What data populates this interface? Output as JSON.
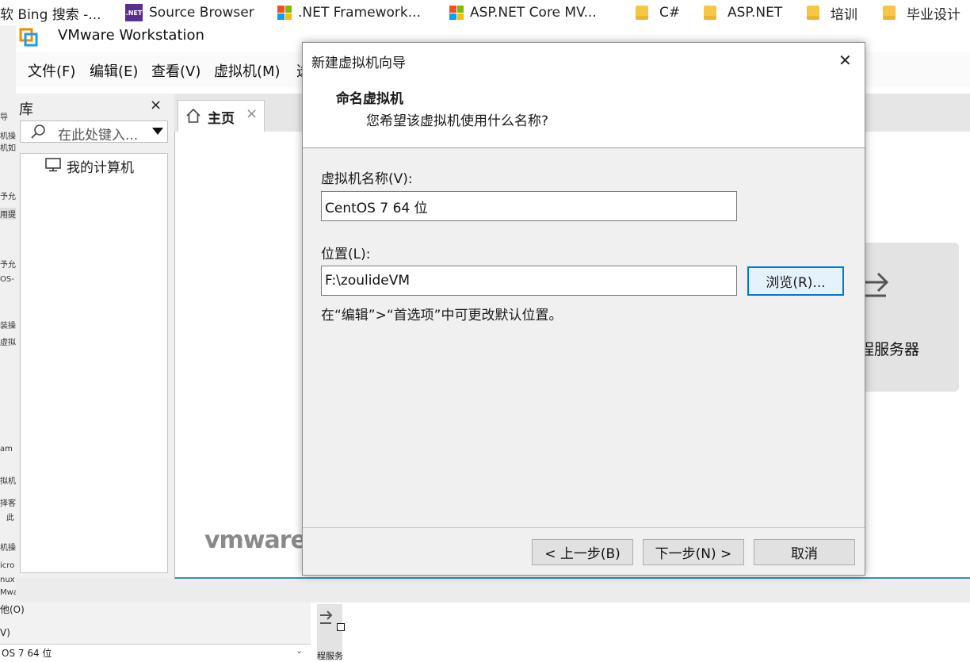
{
  "bookmarks": [
    {
      "label": "软 Bing 搜索 -...",
      "icon": "text-fragment"
    },
    {
      "label": "Source Browser",
      "icon": "dotnet-icon",
      "icon_text": ".NET"
    },
    {
      "label": ".NET Framework...",
      "icon": "microsoft-logo-icon"
    },
    {
      "label": "ASP.NET Core MV...",
      "icon": "microsoft-logo-icon"
    },
    {
      "label": "C#",
      "icon": "folder-icon"
    },
    {
      "label": "ASP.NET",
      "icon": "folder-icon"
    },
    {
      "label": "培训",
      "icon": "folder-icon"
    },
    {
      "label": "毕业设计",
      "icon": "folder-icon"
    }
  ],
  "app": {
    "title": "VMware Workstation",
    "menu": [
      "文件(F)",
      "编辑(E)",
      "查看(V)",
      "虚拟机(M)",
      "选"
    ]
  },
  "library": {
    "title": "库",
    "close": "×",
    "search_placeholder": "在此处键入...",
    "tree": [
      {
        "label": "我的计算机",
        "icon": "computer-icon"
      }
    ]
  },
  "tabs": [
    {
      "label": "主页",
      "icon": "home-icon",
      "close": "×"
    }
  ],
  "home": {
    "remote_card_label": "程服务器",
    "brand": "vmware"
  },
  "background_fragments": [
    "导",
    "机操",
    "机如",
    "予允",
    "用提",
    "予允",
    "OS-",
    "装操",
    "虚拟",
    "am",
    "拟机",
    "择客",
    "此",
    "机操",
    "icro",
    "nux",
    "Mwa"
  ],
  "lower": {
    "other_label": "他(O)",
    "v_label": "V)",
    "select_value": "OS 7 64 位",
    "select_arrow": "⌄",
    "card_text": "程服务"
  },
  "dialog": {
    "title": "新建虚拟机向导",
    "close": "✕",
    "heading": "命名虚拟机",
    "subheading": "您希望该虚拟机使用什么名称?",
    "name_label": "虚拟机名称(V):",
    "name_value": "CentOS 7 64 位",
    "location_label": "位置(L):",
    "location_value": "F:\\zoulideVM",
    "browse_button": "浏览(R)...",
    "hint": "在“编辑”>“首选项”中可更改默认位置。",
    "back_button": "< 上一步(B)",
    "next_button": "下一步(N) >",
    "cancel_button": "取消"
  },
  "colors": {
    "accent_focus": "#0078d7",
    "dialog_bg": "#f0f0f0",
    "vmware_orange": "#f38b00",
    "vmware_blue": "#1d9fd9"
  }
}
